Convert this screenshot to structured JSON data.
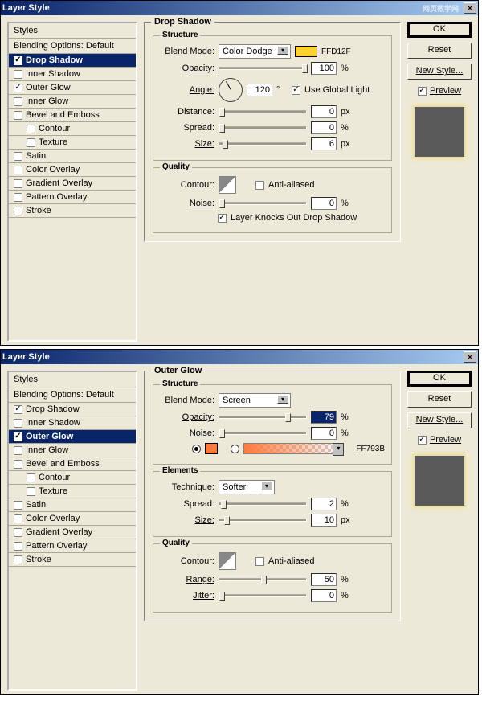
{
  "dialogs": [
    {
      "title": "Layer Style",
      "watermark": "网页教学网",
      "styles_header": "Styles",
      "blending": "Blending Options: Default",
      "items": [
        {
          "label": "Drop Shadow",
          "checked": true,
          "selected": true
        },
        {
          "label": "Inner Shadow",
          "checked": false
        },
        {
          "label": "Outer Glow",
          "checked": true
        },
        {
          "label": "Inner Glow",
          "checked": false
        },
        {
          "label": "Bevel and Emboss",
          "checked": false
        },
        {
          "label": "Contour",
          "checked": false,
          "indent": true
        },
        {
          "label": "Texture",
          "checked": false,
          "indent": true
        },
        {
          "label": "Satin",
          "checked": false
        },
        {
          "label": "Color Overlay",
          "checked": false
        },
        {
          "label": "Gradient Overlay",
          "checked": false
        },
        {
          "label": "Pattern Overlay",
          "checked": false
        },
        {
          "label": "Stroke",
          "checked": false
        }
      ],
      "panel_title": "Drop Shadow",
      "structure": {
        "legend": "Structure",
        "blend_mode_label": "Blend Mode:",
        "blend_mode": "Color Dodge",
        "swatch": "#FFD12F",
        "hex": "FFD12F",
        "opacity_label": "Opacity:",
        "opacity": "100",
        "opacity_unit": "%",
        "angle_label": "Angle:",
        "angle": "120",
        "angle_unit": "°",
        "global_light": "Use Global Light",
        "distance_label": "Distance:",
        "distance": "0",
        "distance_unit": "px",
        "spread_label": "Spread:",
        "spread": "0",
        "spread_unit": "%",
        "size_label": "Size:",
        "size": "6",
        "size_unit": "px"
      },
      "quality": {
        "legend": "Quality",
        "contour_label": "Contour:",
        "aa_label": "Anti-aliased",
        "noise_label": "Noise:",
        "noise": "0",
        "noise_unit": "%",
        "knock_label": "Layer Knocks Out Drop Shadow"
      },
      "buttons": {
        "ok": "OK",
        "reset": "Reset",
        "newstyle": "New Style...",
        "preview": "Preview"
      }
    },
    {
      "title": "Layer Style",
      "styles_header": "Styles",
      "blending": "Blending Options: Default",
      "items": [
        {
          "label": "Drop Shadow",
          "checked": true
        },
        {
          "label": "Inner Shadow",
          "checked": false
        },
        {
          "label": "Outer Glow",
          "checked": true,
          "selected": true
        },
        {
          "label": "Inner Glow",
          "checked": false
        },
        {
          "label": "Bevel and Emboss",
          "checked": false
        },
        {
          "label": "Contour",
          "checked": false,
          "indent": true
        },
        {
          "label": "Texture",
          "checked": false,
          "indent": true
        },
        {
          "label": "Satin",
          "checked": false
        },
        {
          "label": "Color Overlay",
          "checked": false
        },
        {
          "label": "Gradient Overlay",
          "checked": false
        },
        {
          "label": "Pattern Overlay",
          "checked": false
        },
        {
          "label": "Stroke",
          "checked": false
        }
      ],
      "panel_title": "Outer Glow",
      "structure": {
        "legend": "Structure",
        "blend_mode_label": "Blend Mode:",
        "blend_mode": "Screen",
        "opacity_label": "Opacity:",
        "opacity": "79",
        "opacity_unit": "%",
        "noise_label": "Noise:",
        "noise": "0",
        "noise_unit": "%",
        "swatch": "#FF793B",
        "hex": "FF793B"
      },
      "elements": {
        "legend": "Elements",
        "technique_label": "Technique:",
        "technique": "Softer",
        "spread_label": "Spread:",
        "spread": "2",
        "spread_unit": "%",
        "size_label": "Size:",
        "size": "10",
        "size_unit": "px"
      },
      "quality": {
        "legend": "Quality",
        "contour_label": "Contour:",
        "aa_label": "Anti-aliased",
        "range_label": "Range:",
        "range": "50",
        "range_unit": "%",
        "jitter_label": "Jitter:",
        "jitter": "0",
        "jitter_unit": "%"
      },
      "buttons": {
        "ok": "OK",
        "reset": "Reset",
        "newstyle": "New Style...",
        "preview": "Preview"
      }
    }
  ]
}
